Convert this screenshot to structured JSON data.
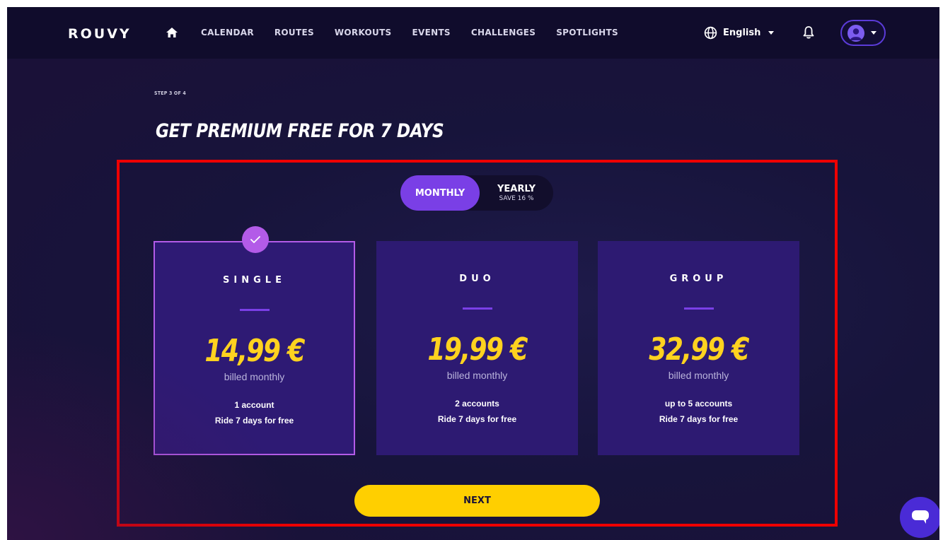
{
  "header": {
    "logo_text": "ROUVY",
    "nav": [
      "CALENDAR",
      "ROUTES",
      "WORKOUTS",
      "EVENTS",
      "CHALLENGES",
      "SPOTLIGHTS"
    ],
    "language": "English",
    "icons": [
      "home-icon",
      "globe-icon",
      "bell-icon",
      "avatar-icon"
    ]
  },
  "page": {
    "step": "STEP 3 OF 4",
    "title": "GET PREMIUM FREE FOR 7 DAYS"
  },
  "billing_toggle": {
    "monthly_label": "MONTHLY",
    "yearly_label": "YEARLY",
    "yearly_save": "SAVE 16 %",
    "selected": "monthly"
  },
  "plans": [
    {
      "name": "SINGLE",
      "price": "14,99 €",
      "billed": "billed monthly",
      "accounts": "1 account",
      "trial": "Ride 7 days for free",
      "selected": true
    },
    {
      "name": "DUO",
      "price": "19,99 €",
      "billed": "billed monthly",
      "accounts": "2 accounts",
      "trial": "Ride 7 days for free",
      "selected": false
    },
    {
      "name": "GROUP",
      "price": "32,99 €",
      "billed": "billed monthly",
      "accounts": "up to 5 accounts",
      "trial": "Ride 7 days for free",
      "selected": false
    }
  ],
  "actions": {
    "next_label": "NEXT"
  },
  "colors": {
    "accent_purple": "#7a3fe6",
    "price_yellow": "#ffd21f",
    "button_yellow": "#ffcf00",
    "highlight_red": "#ee0000"
  }
}
